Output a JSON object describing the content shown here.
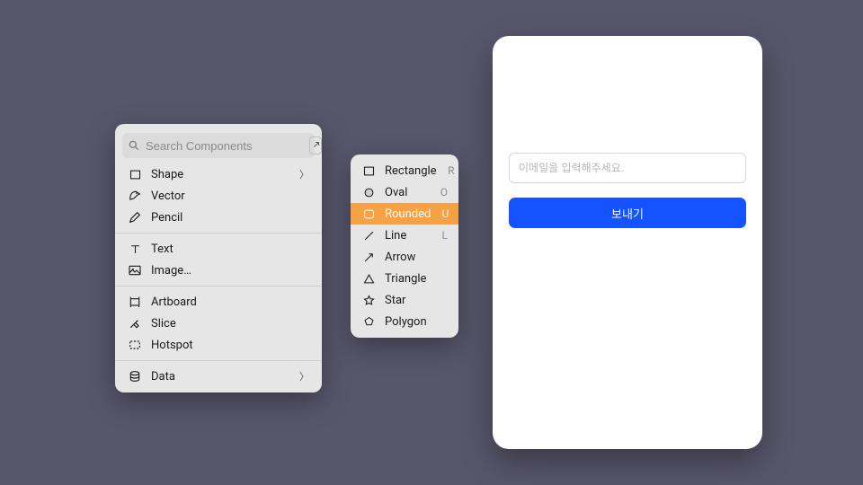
{
  "insert_panel": {
    "search_placeholder": "Search Components",
    "groups": [
      {
        "items": [
          {
            "id": "shape",
            "label": "Shape",
            "icon": "rect",
            "chevron": true
          },
          {
            "id": "vector",
            "label": "Vector",
            "icon": "pen"
          },
          {
            "id": "pencil",
            "label": "Pencil",
            "icon": "pencil"
          }
        ]
      },
      {
        "items": [
          {
            "id": "text",
            "label": "Text",
            "icon": "text"
          },
          {
            "id": "image",
            "label": "Image…",
            "icon": "image"
          }
        ]
      },
      {
        "items": [
          {
            "id": "artboard",
            "label": "Artboard",
            "icon": "artboard"
          },
          {
            "id": "slice",
            "label": "Slice",
            "icon": "slice"
          },
          {
            "id": "hotspot",
            "label": "Hotspot",
            "icon": "hotspot"
          }
        ]
      },
      {
        "items": [
          {
            "id": "data",
            "label": "Data",
            "icon": "data",
            "chevron": true
          }
        ]
      }
    ]
  },
  "shape_submenu": {
    "items": [
      {
        "id": "rectangle",
        "label": "Rectangle",
        "icon": "rect",
        "key": "R"
      },
      {
        "id": "oval",
        "label": "Oval",
        "icon": "oval",
        "key": "O"
      },
      {
        "id": "rounded",
        "label": "Rounded",
        "icon": "rounded",
        "key": "U",
        "active": true
      },
      {
        "id": "line",
        "label": "Line",
        "icon": "line",
        "key": "L"
      },
      {
        "id": "arrow",
        "label": "Arrow",
        "icon": "arrow"
      },
      {
        "id": "triangle",
        "label": "Triangle",
        "icon": "triangle"
      },
      {
        "id": "star",
        "label": "Star",
        "icon": "star"
      },
      {
        "id": "polygon",
        "label": "Polygon",
        "icon": "polygon"
      }
    ]
  },
  "preview": {
    "email_placeholder": "이메일을 입력해주세요.",
    "send_label": "보내기"
  },
  "colors": {
    "accent": "#f5a146",
    "primary": "#1453ff"
  }
}
